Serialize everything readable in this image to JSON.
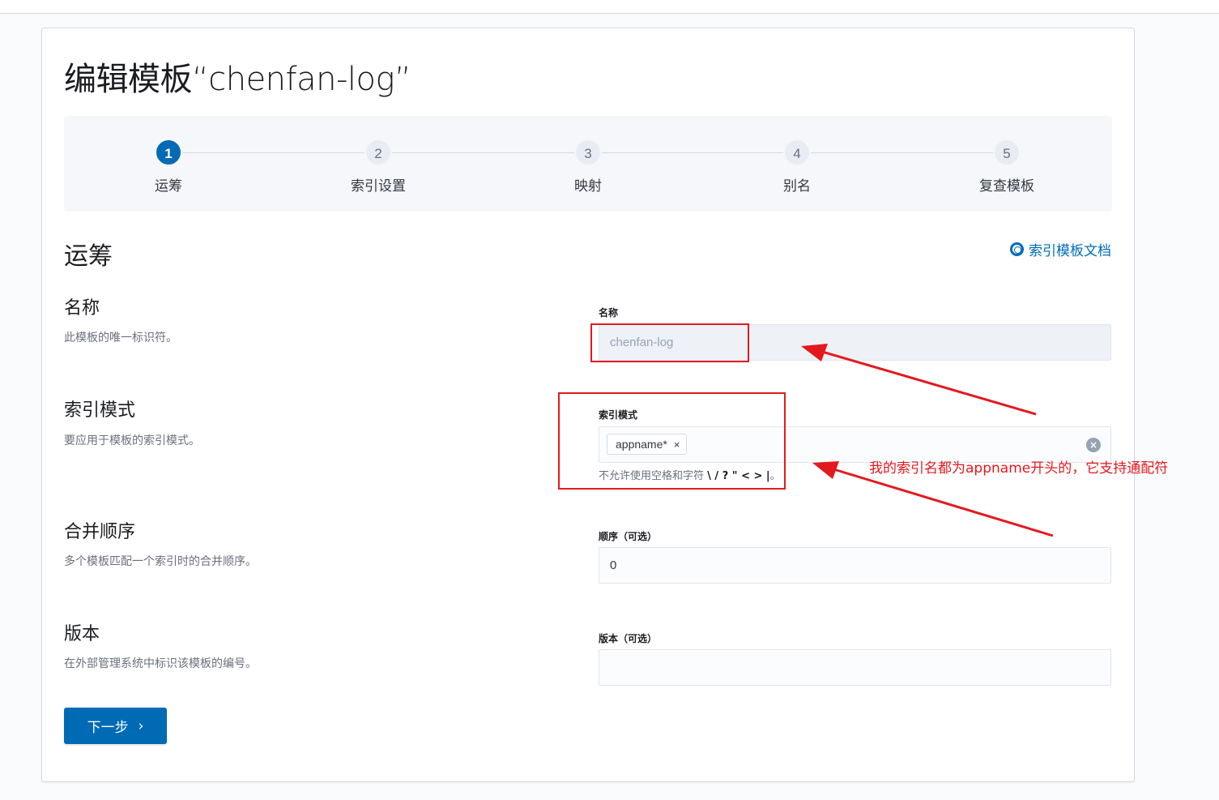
{
  "page": {
    "title": "编辑模板“chenfan-log”"
  },
  "steps": [
    {
      "number": "1",
      "label": "运筹",
      "active": true
    },
    {
      "number": "2",
      "label": "索引设置",
      "active": false
    },
    {
      "number": "3",
      "label": "映射",
      "active": false
    },
    {
      "number": "4",
      "label": "别名",
      "active": false
    },
    {
      "number": "5",
      "label": "复查模板",
      "active": false
    }
  ],
  "section": {
    "title": "运筹",
    "doc_link": "索引模板文档"
  },
  "fields": {
    "name": {
      "title": "名称",
      "description": "此模板的唯一标识符。",
      "label": "名称",
      "value": "chenfan-log"
    },
    "index_patterns": {
      "title": "索引模式",
      "description": "要应用于模板的索引模式。",
      "label": "索引模式",
      "pill": "appname*",
      "help_prefix": "不允许使用空格和字符",
      "help_chars": "\\ / ? \" < > |",
      "help_suffix": "。"
    },
    "order": {
      "title": "合并顺序",
      "description": "多个模板匹配一个索引时的合并顺序。",
      "label": "顺序（可选）",
      "value": "0"
    },
    "version": {
      "title": "版本",
      "description": "在外部管理系统中标识该模板的编号。",
      "label": "版本（可选）",
      "value": ""
    }
  },
  "next_button": {
    "label": "下一步",
    "chevron": "›"
  },
  "annotation": {
    "text": "我的索引名都为appname开头的，它支持通配符",
    "color": "#e4191e"
  },
  "icons": {
    "doc": "lifebuoy-icon",
    "pill_close": "×",
    "clear": "×"
  },
  "colors": {
    "primary": "#006bb4",
    "annotation": "#e4191e"
  }
}
